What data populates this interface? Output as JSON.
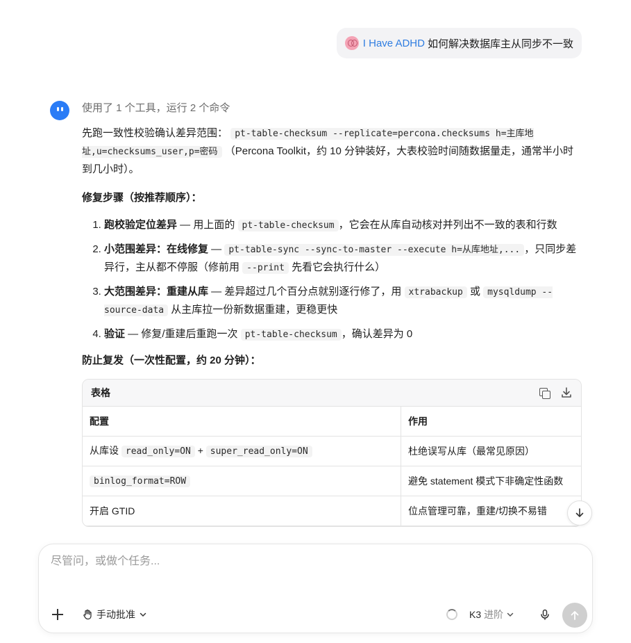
{
  "user_message": {
    "skill": "I Have ADHD",
    "text": "如何解决数据库主从同步不一致"
  },
  "assistant": {
    "tool_status": "使用了 1 个工具，运行 2 个命令",
    "intro_pre": "先跑一致性校验确认差异范围：",
    "intro_code": "pt-table-checksum --replicate=percona.checksums h=主库地址,u=checksums_user,p=密码",
    "intro_post": "（Percona Toolkit，约 10 分钟装好，大表校验时间随数据量走，通常半小时到几小时）。",
    "repair_title": "修复步骤（按推荐顺序）：",
    "steps": [
      {
        "title": "跑校验定位差异",
        "pre": " — 用上面的 ",
        "code": "pt-table-checksum",
        "post": "，它会在从库自动核对并列出不一致的表和行数"
      },
      {
        "title": "小范围差异：在线修复",
        "pre": " — ",
        "code": "pt-table-sync --sync-to-master --execute h=从库地址,...",
        "mid": "，只同步差异行，主从都不停服（修前用 ",
        "code2": "--print",
        "post": " 先看它会执行什么）"
      },
      {
        "title": "大范围差异：重建从库",
        "pre": " — 差异超过几个百分点就别逐行修了，用 ",
        "code": "xtrabackup",
        "mid": " 或 ",
        "code2": "mysqldump --source-data",
        "post": " 从主库拉一份新数据重建，更稳更快"
      },
      {
        "title": "验证",
        "pre": " — 修复/重建后重跑一次 ",
        "code": "pt-table-checksum",
        "post": "，确认差异为 0"
      }
    ],
    "prevent_title": "防止复发（一次性配置，约 20 分钟）：",
    "table": {
      "header_label": "表格",
      "columns": [
        "配置",
        "作用"
      ],
      "rows": [
        {
          "c1_pre": "从库设 ",
          "c1_code": "read_only=ON",
          "c1_mid": " + ",
          "c1_code2": "super_read_only=ON",
          "c2": "杜绝误写从库（最常见原因）"
        },
        {
          "c1_pre": "",
          "c1_code": "binlog_format=ROW",
          "c1_mid": "",
          "c1_code2": "",
          "c2": "避免 statement 模式下非确定性函数"
        },
        {
          "c1_pre": "开启 GTID",
          "c1_code": "",
          "c1_mid": "",
          "c1_code2": "",
          "c2": "位点管理可靠，重建/切换不易错"
        }
      ]
    }
  },
  "composer": {
    "placeholder": "尽管问，或做个任务...",
    "approve_label": "手动批准",
    "model_name": "K3",
    "model_tier": "进阶"
  }
}
